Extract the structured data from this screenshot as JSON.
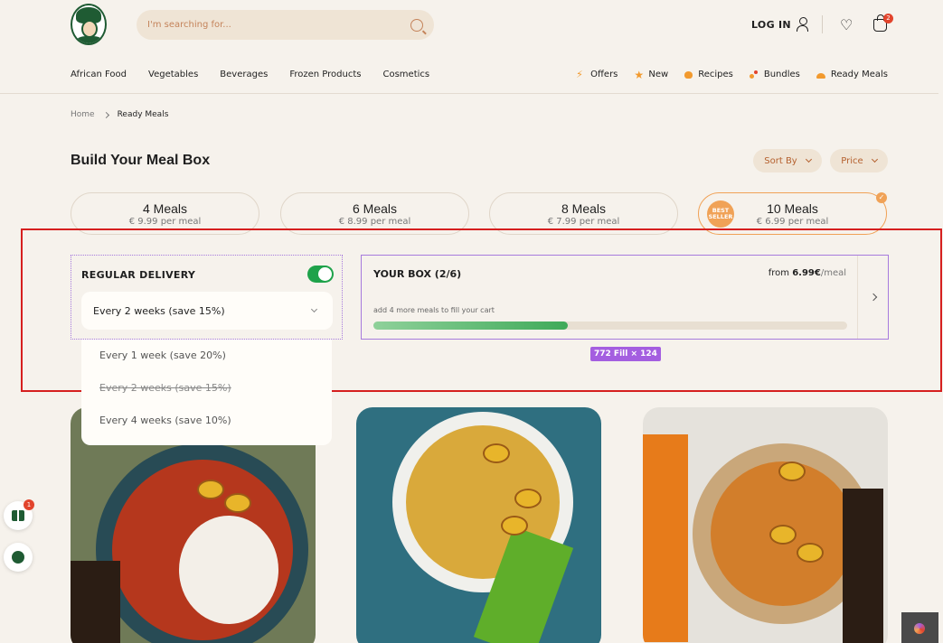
{
  "header": {
    "search_placeholder": "I'm searching for...",
    "login_label": "LOG IN",
    "cart_count": "2"
  },
  "nav": {
    "categories": [
      "African Food",
      "Vegetables",
      "Beverages",
      "Frozen Products",
      "Cosmetics"
    ],
    "promos": [
      {
        "label": "Offers",
        "icon": "bolt-icon"
      },
      {
        "label": "New",
        "icon": "star-icon"
      },
      {
        "label": "Recipes",
        "icon": "recipe-icon"
      },
      {
        "label": "Bundles",
        "icon": "bundle-icon"
      },
      {
        "label": "Ready Meals",
        "icon": "meal-icon"
      }
    ]
  },
  "breadcrumb": {
    "home": "Home",
    "current": "Ready Meals"
  },
  "page": {
    "title": "Build Your Meal Box",
    "sort_label": "Sort By",
    "price_label": "Price"
  },
  "plans": [
    {
      "title": "4 Meals",
      "price": "€ 9.99 per meal"
    },
    {
      "title": "6 Meals",
      "price": "€ 8.99 per meal"
    },
    {
      "title": "8 Meals",
      "price": "€ 7.99 per meal"
    },
    {
      "title": "10 Meals",
      "price": "€ 6.99 per meal",
      "badge": "BEST SELLER"
    }
  ],
  "delivery": {
    "label": "REGULAR DELIVERY",
    "enabled": true,
    "selected": "Every 2 weeks (save 15%)",
    "options": [
      "Every 1 week (save 20%)",
      "Every 2 weeks (save 15%)",
      "Every 4 weeks (save 10%)"
    ]
  },
  "box": {
    "title": "YOUR BOX (2/6)",
    "from_prefix": "from",
    "from_price": "6.99€",
    "from_unit": "/meal",
    "hint": "add 4 more meals to fill your cart",
    "progress": 0.41
  },
  "overlay": {
    "dimension_tag": "772 Fill × 124"
  },
  "floating": {
    "gift_count": "1"
  },
  "colors": {
    "accent": "#f0a257",
    "brand_green": "#1f5b33",
    "toggle_on": "#1ea24a",
    "selection": "#a77bdd",
    "highlight": "#d61f1f"
  }
}
